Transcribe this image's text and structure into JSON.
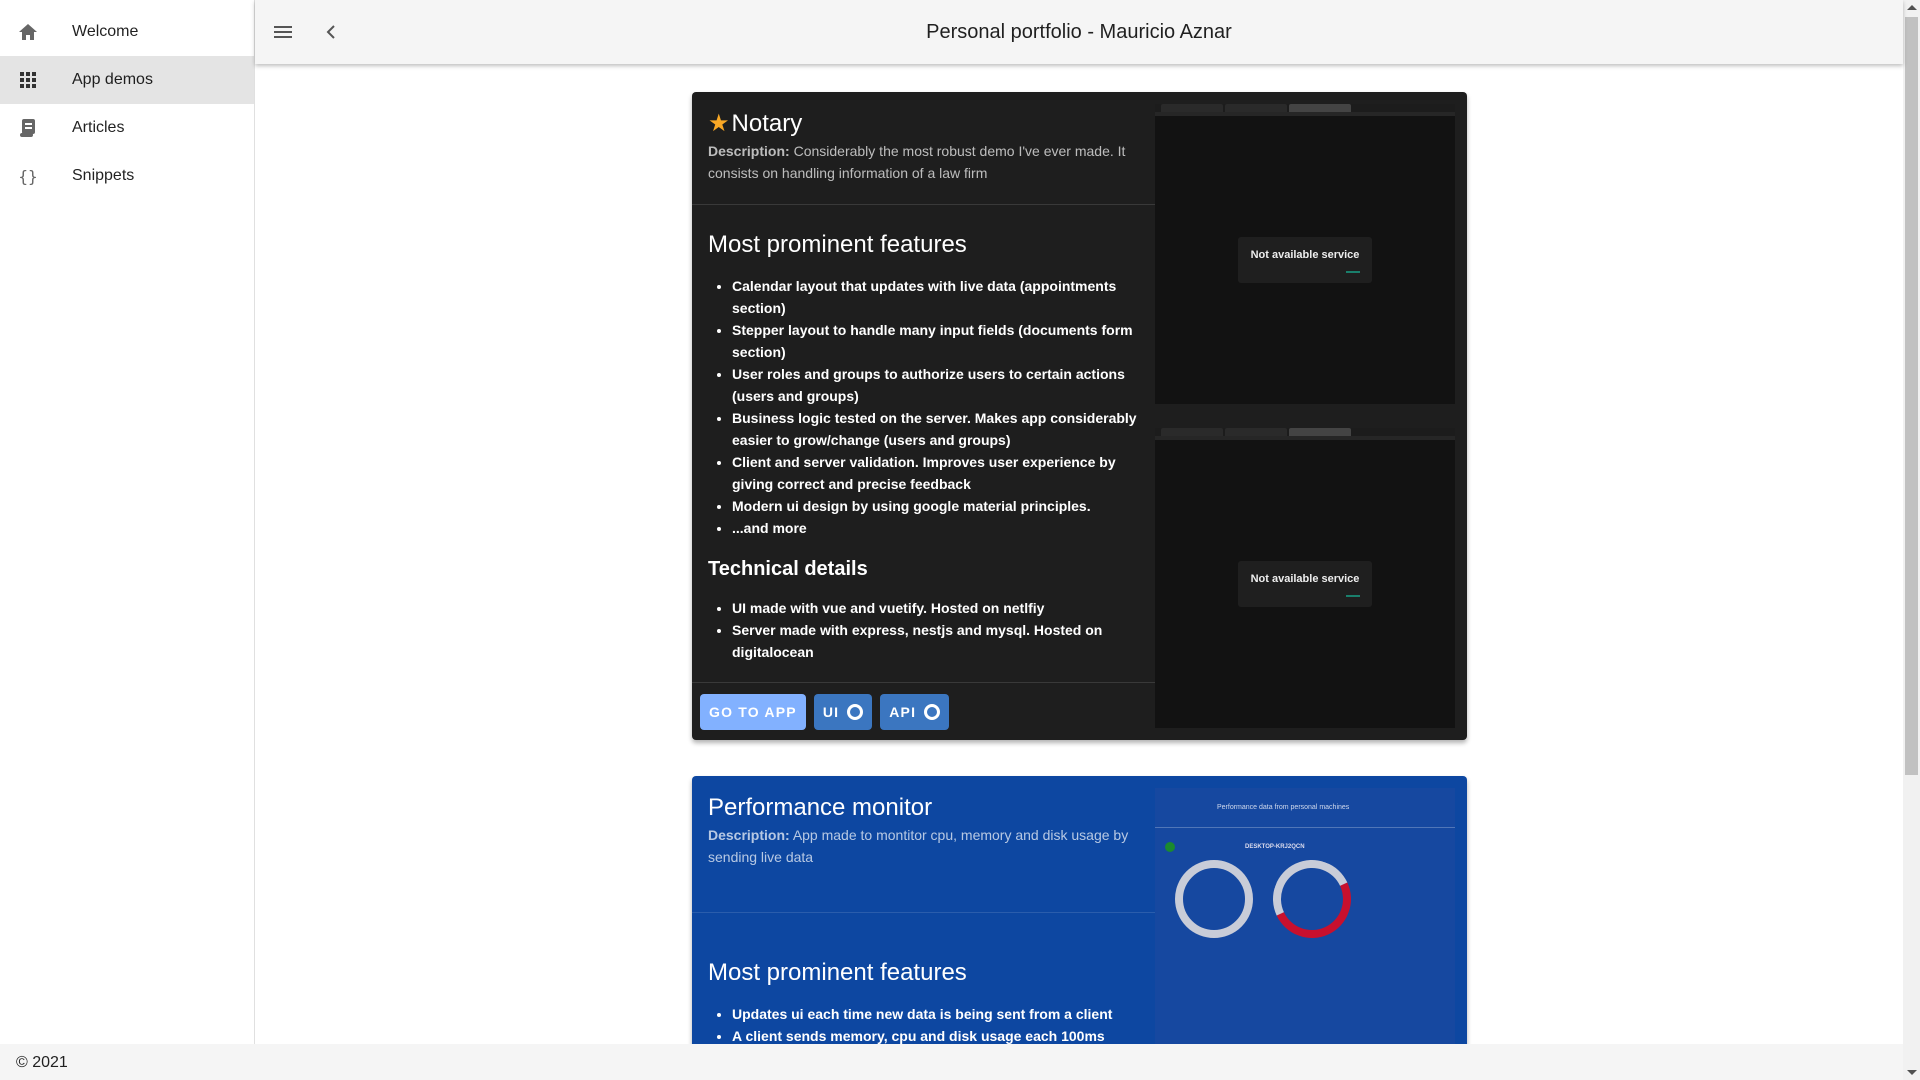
{
  "sidebar": {
    "items": [
      {
        "label": "Welcome",
        "icon": "home-icon"
      },
      {
        "label": "App demos",
        "icon": "apps-grid-icon",
        "active": true
      },
      {
        "label": "Articles",
        "icon": "article-icon"
      },
      {
        "label": "Snippets",
        "icon": "code-braces-icon"
      }
    ]
  },
  "header": {
    "title": "Personal portfolio - Mauricio Aznar",
    "menu_icon": "menu-icon",
    "back_icon": "chevron-left-icon"
  },
  "cards": [
    {
      "title": "Notary",
      "starred": true,
      "description_label": "Description:",
      "description": "Considerably the most robust demo I've ever made. It consists on handling information of a law firm",
      "features_title": "Most prominent features",
      "features": [
        "Calendar layout that updates with live data (appointments section)",
        "Stepper layout to handle many input fields (documents form section)",
        "User roles and groups to authorize users to certain actions (users and groups)",
        "Business logic tested on the server. Makes app considerably easier to grow/change (users and groups)",
        "Client and server validation. Improves user experience by giving correct and precise feedback",
        "Modern ui design by using google material principles.",
        "...and more"
      ],
      "technical_title": "Technical details",
      "technical": [
        "UI made with vue and vuetify. Hosted on netlfiy",
        "Server made with express, nestjs and mysql. Hosted on digitalocean"
      ],
      "buttons": {
        "go": "GO TO APP",
        "ui": "UI",
        "api": "API"
      },
      "screenshot_text": "Not available service",
      "background": "#1e1e1e"
    },
    {
      "title": "Performance monitor",
      "description_label": "Description:",
      "description": "App made to montitor cpu, memory and disk usage by sending live data",
      "features_title": "Most prominent features",
      "features": [
        "Updates ui each time new data is being sent from a client",
        "A client sends memory, cpu and disk usage each 100ms"
      ],
      "screenshot_title": "Performance data from personal machines",
      "screenshot_machine": "DESKTOP-KRJ2QCN",
      "background": "#0d47a1"
    }
  ],
  "footer": {
    "text": "© 2021"
  },
  "colors": {
    "accent": "#82b1ff",
    "star": "#f9a825"
  }
}
